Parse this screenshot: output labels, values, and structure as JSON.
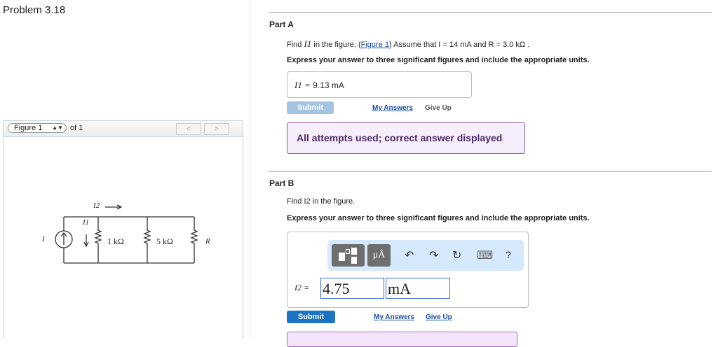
{
  "title": "Problem 3.18",
  "figure": {
    "select": "Figure 1",
    "of": "of 1",
    "prev": "<",
    "next": ">",
    "labels": {
      "i": "I",
      "i1": "I1",
      "i2": "I2",
      "r1": "1 kΩ",
      "r2": "5 kΩ",
      "r": "R"
    }
  },
  "partA": {
    "heading": "Part A",
    "q_pre": "Find ",
    "q_var": "I1",
    "q_mid": " in the figure. (",
    "q_link": "Figure 1",
    "q_post": ") Assume that I = 14 mA and R = 3.0 kΩ .",
    "instr": "Express your answer to three significant figures and include the appropriate units.",
    "ans_label": "I1 =",
    "ans_value": "9.13 mA",
    "submit": "Submit",
    "my_answers": "My Answers",
    "give_up": "Give Up",
    "alert": "All attempts used; correct answer displayed"
  },
  "partB": {
    "heading": "Part B",
    "q": "Find I2 in the figure.",
    "instr": "Express your answer to three significant figures and include the appropriate units.",
    "tool_units": "μÅ",
    "undo": "↶",
    "redo": "↷",
    "reset": "↻",
    "keyboard": "⌨",
    "help": "?",
    "ans_label": "I2 =",
    "value": "4.75",
    "unit": "mA",
    "submit": "Submit",
    "my_answers": "My Answers",
    "give_up": "Give Up"
  }
}
